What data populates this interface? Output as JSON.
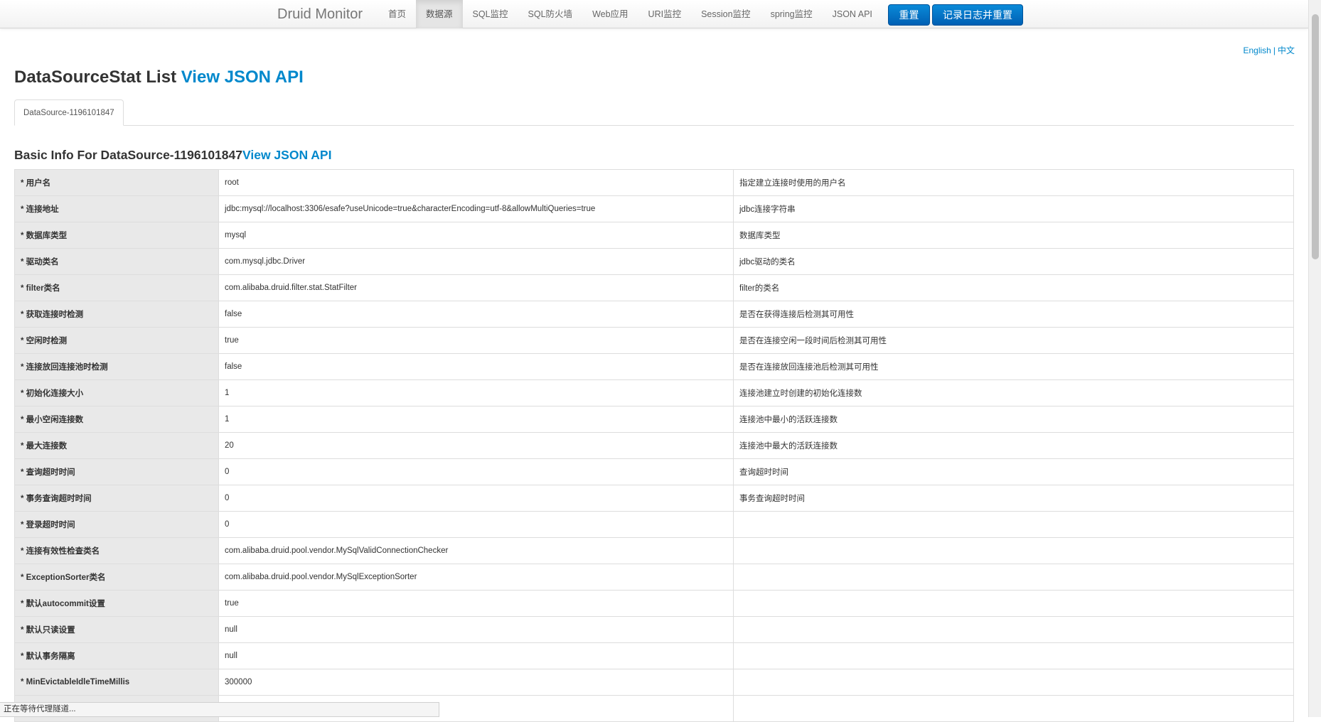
{
  "navbar": {
    "brand": "Druid Monitor",
    "items": [
      {
        "label": "首页",
        "active": false
      },
      {
        "label": "数据源",
        "active": true
      },
      {
        "label": "SQL监控",
        "active": false
      },
      {
        "label": "SQL防火墙",
        "active": false
      },
      {
        "label": "Web应用",
        "active": false
      },
      {
        "label": "URI监控",
        "active": false
      },
      {
        "label": "Session监控",
        "active": false
      },
      {
        "label": "spring监控",
        "active": false
      },
      {
        "label": "JSON API",
        "active": false
      }
    ],
    "reset_label": "重置",
    "log_reset_label": "记录日志并重置"
  },
  "lang": {
    "english": "English",
    "separator": "|",
    "chinese": "中文"
  },
  "page": {
    "title": "DataSourceStat List",
    "title_link": "View JSON API",
    "tab": "DataSource-1196101847",
    "section_title": "Basic Info For DataSource-1196101847",
    "section_link": "View JSON API"
  },
  "rows": [
    {
      "label": "* 用户名",
      "value": "root",
      "desc": "指定建立连接时使用的用户名"
    },
    {
      "label": "* 连接地址",
      "value": "jdbc:mysql://localhost:3306/esafe?useUnicode=true&characterEncoding=utf-8&allowMultiQueries=true",
      "desc": "jdbc连接字符串"
    },
    {
      "label": "* 数据库类型",
      "value": "mysql",
      "desc": "数据库类型"
    },
    {
      "label": "* 驱动类名",
      "value": "com.mysql.jdbc.Driver",
      "desc": "jdbc驱动的类名"
    },
    {
      "label": "* filter类名",
      "value": "com.alibaba.druid.filter.stat.StatFilter",
      "desc": "filter的类名"
    },
    {
      "label": "* 获取连接时检测",
      "value": "false",
      "desc": "是否在获得连接后检测其可用性"
    },
    {
      "label": "* 空闲时检测",
      "value": "true",
      "desc": "是否在连接空闲一段时间后检测其可用性"
    },
    {
      "label": "* 连接放回连接池时检测",
      "value": "false",
      "desc": "是否在连接放回连接池后检测其可用性"
    },
    {
      "label": "* 初始化连接大小",
      "value": "1",
      "desc": "连接池建立时创建的初始化连接数"
    },
    {
      "label": "* 最小空闲连接数",
      "value": "1",
      "desc": "连接池中最小的活跃连接数"
    },
    {
      "label": "* 最大连接数",
      "value": "20",
      "desc": "连接池中最大的活跃连接数"
    },
    {
      "label": "* 查询超时时间",
      "value": "0",
      "desc": "查询超时时间"
    },
    {
      "label": "* 事务查询超时时间",
      "value": "0",
      "desc": "事务查询超时时间"
    },
    {
      "label": "* 登录超时时间",
      "value": "0",
      "desc": ""
    },
    {
      "label": "* 连接有效性检查类名",
      "value": "com.alibaba.druid.pool.vendor.MySqlValidConnectionChecker",
      "desc": ""
    },
    {
      "label": "* ExceptionSorter类名",
      "value": "com.alibaba.druid.pool.vendor.MySqlExceptionSorter",
      "desc": ""
    },
    {
      "label": "* 默认autocommit设置",
      "value": "true",
      "desc": ""
    },
    {
      "label": "* 默认只读设置",
      "value": "null",
      "desc": ""
    },
    {
      "label": "* 默认事务隔离",
      "value": "null",
      "desc": ""
    },
    {
      "label": "* MinEvictableIdleTimeMillis",
      "value": "300000",
      "desc": ""
    },
    {
      "label": "",
      "value": "",
      "desc": ""
    }
  ],
  "status_bar": "正在等待代理隧道..."
}
